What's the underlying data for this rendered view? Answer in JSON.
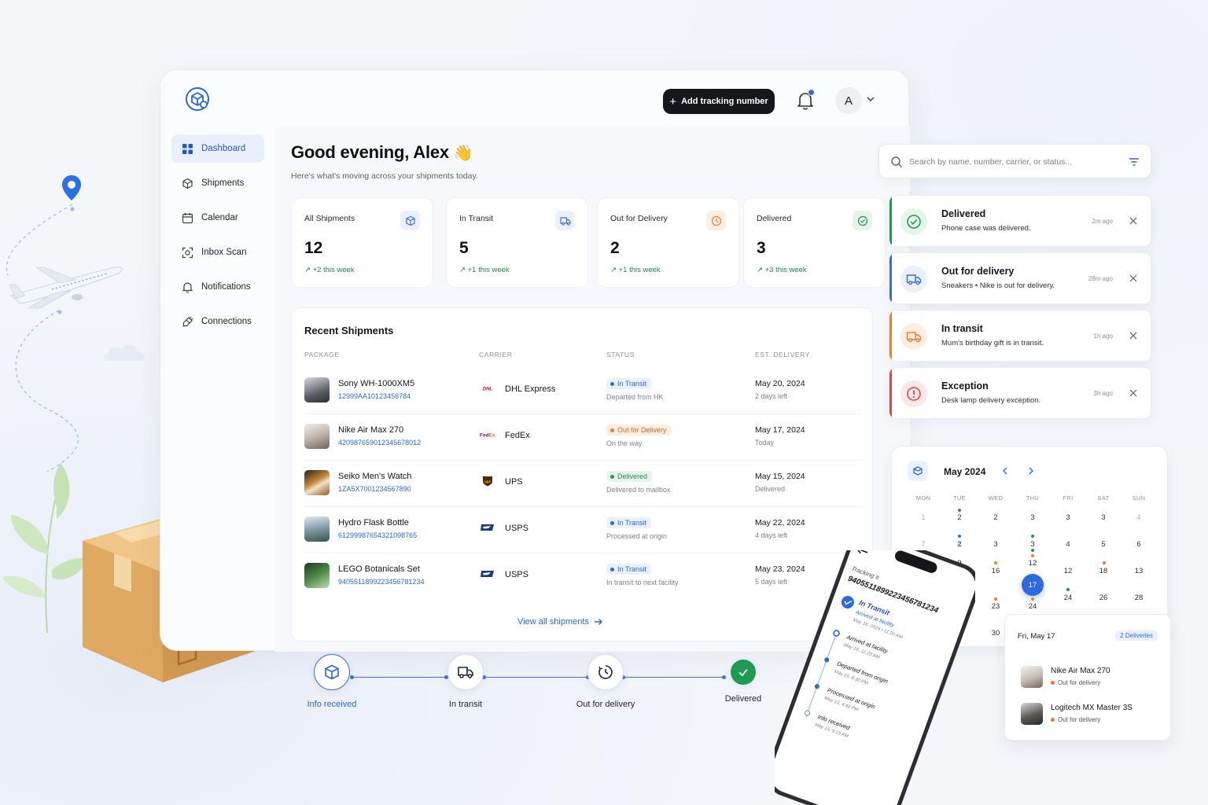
{
  "header": {
    "add_button": "Add tracking number",
    "avatar_initial": "A"
  },
  "sidebar": {
    "items": [
      {
        "label": "Dashboard",
        "icon": "grid-icon",
        "active": true
      },
      {
        "label": "Shipments",
        "icon": "box-icon"
      },
      {
        "label": "Calendar",
        "icon": "calendar-icon"
      },
      {
        "label": "Inbox Scan",
        "icon": "scan-icon"
      },
      {
        "label": "Notifications",
        "icon": "bell-icon"
      },
      {
        "label": "Connections",
        "icon": "plug-icon"
      }
    ]
  },
  "greeting": {
    "title": "Good evening, Alex",
    "emoji": "👋",
    "subtitle": "Here's what's moving across your shipments today."
  },
  "stats": [
    {
      "label": "All Shipments",
      "value": "12",
      "change": "+2 this week",
      "icon": "box-icon",
      "color": "#3a6fd8"
    },
    {
      "label": "In Transit",
      "value": "5",
      "change": "+1 this week",
      "icon": "truck-icon",
      "color": "#3a6fd8"
    },
    {
      "label": "Out for Delivery",
      "value": "2",
      "change": "+1 this week",
      "icon": "clock-icon",
      "color": "#ef7d2a"
    },
    {
      "label": "Delivered",
      "value": "3",
      "change": "+3 this week",
      "icon": "check-circle-icon",
      "color": "#1f9a52"
    }
  ],
  "recent": {
    "title": "Recent Shipments",
    "columns": [
      "PACKAGE",
      "CARRIER",
      "STATUS",
      "EST. DELIVERY"
    ],
    "rows": [
      {
        "name": "Sony WH-1000XM5",
        "tracking": "12999AA10123456784",
        "carrier": "DHL Express",
        "status": "In Transit",
        "status_desc": "Departed from HK",
        "date": "May 20, 2024",
        "left": "2 days left"
      },
      {
        "name": "Nike Air Max 270",
        "tracking": "420987659012345678012",
        "carrier": "FedEx",
        "status": "Out for Delivery",
        "status_desc": "On the way",
        "date": "May 17, 2024",
        "left": "Today"
      },
      {
        "name": "Seiko Men's Watch",
        "tracking": "1ZA5X7001234567890",
        "carrier": "UPS",
        "status": "Delivered",
        "status_desc": "Delivered to mailbox",
        "date": "May 15, 2024",
        "left": "Delivered"
      },
      {
        "name": "Hydro Flask Bottle",
        "tracking": "61299987654321098765",
        "carrier": "USPS",
        "status": "In Transit",
        "status_desc": "Processed at origin",
        "date": "May 22, 2024",
        "left": "4 days left"
      },
      {
        "name": "LEGO Botanicals Set",
        "tracking": "9405511899223456781234",
        "carrier": "USPS",
        "status": "In Transit",
        "status_desc": "In transit to next facility",
        "date": "May 23, 2024",
        "left": "5 days left"
      }
    ],
    "view_all": "View all shipments"
  },
  "stepper": [
    "Info received",
    "In transit",
    "Out for delivery",
    "Delivered"
  ],
  "search": {
    "placeholder": "Search by name, number, carrier, or status..."
  },
  "notifications": [
    {
      "title": "Delivered",
      "desc": "Phone case was delivered.",
      "time": "2m ago",
      "color": "#1f9a52"
    },
    {
      "title": "Out for delivery",
      "desc": "Sneakers • Nike is out for delivery.",
      "time": "28m ago",
      "color": "#3a6fd8"
    },
    {
      "title": "In transit",
      "desc": "Mum's birthday gift is in transit.",
      "time": "1h ago",
      "color": "#ef7d2a"
    },
    {
      "title": "Exception",
      "desc": "Desk lamp delivery exception.",
      "time": "3h ago",
      "color": "#e04646"
    }
  ],
  "calendar": {
    "month": "May 2024",
    "weekdays": [
      "MON",
      "TUE",
      "WED",
      "THU",
      "FRI",
      "SAT",
      "SUN"
    ],
    "rows": [
      [
        "1",
        "2",
        "2",
        "3",
        "3",
        "3",
        "4"
      ],
      [
        "7",
        "2",
        "3",
        "3",
        "4",
        "5",
        "6"
      ],
      [
        "",
        "9",
        "16",
        "12",
        "12",
        "18",
        "13"
      ],
      [
        "",
        "",
        "23",
        "17",
        "24",
        "26",
        "28"
      ],
      [
        "",
        "",
        "30",
        "24",
        "",
        "",
        ""
      ]
    ],
    "today": "17",
    "popup": {
      "date": "Fri, May 17",
      "count": "2 Deliveries",
      "items": [
        {
          "name": "Nike Air Max 270",
          "status": "Out for delivery"
        },
        {
          "name": "Logitech MX Master 3S",
          "status": "Out for delivery"
        }
      ]
    }
  },
  "phone": {
    "tracking_label": "Tracking #",
    "tracking_number": "9405511899223456781234",
    "status": "In Transit",
    "status_sub": "Arrived at facility",
    "status_time": "May 16, 2024 • 11:20 AM",
    "events": [
      {
        "title": "Arrived at facility",
        "time": "May 16, 11:20 AM"
      },
      {
        "title": "Departed from origin",
        "time": "May 15, 8:30 PM"
      },
      {
        "title": "Processed at origin",
        "time": "May 15, 4:45 PM"
      },
      {
        "title": "Info received",
        "time": "May 15, 9:15 AM"
      }
    ]
  }
}
